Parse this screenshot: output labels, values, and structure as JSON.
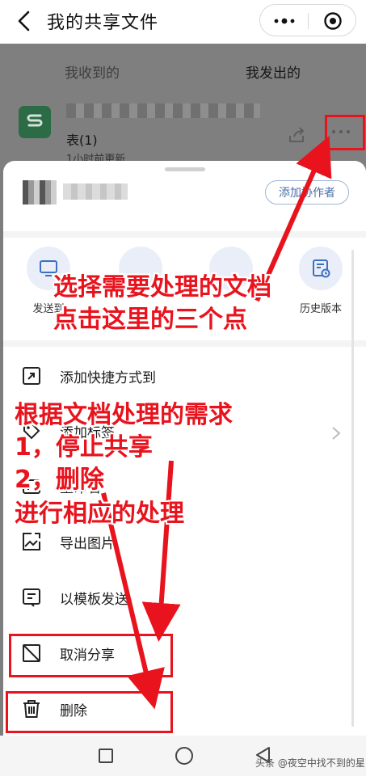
{
  "header": {
    "title": "我的共享文件"
  },
  "tabs": [
    {
      "label": "我收到的"
    },
    {
      "label": "我发出的"
    }
  ],
  "file": {
    "name_suffix": "表(1)",
    "updated": "1小时前更新"
  },
  "sheet": {
    "add_collaborator": "添加协作者",
    "actions": [
      {
        "label": "发送到",
        "icon": "send-icon"
      },
      {
        "label": "历史版本",
        "icon": "history-icon"
      }
    ],
    "menu": [
      {
        "label": "添加快捷方式到",
        "icon": "shortcut-icon"
      },
      {
        "label": "添加标签",
        "icon": "tag-icon"
      },
      {
        "label": "重命名",
        "icon": "rename-icon"
      },
      {
        "label": "导出图片",
        "icon": "export-image-icon"
      },
      {
        "label": "以模板发送",
        "icon": "template-icon"
      },
      {
        "label": "取消分享",
        "icon": "cancel-share-icon"
      },
      {
        "label": "删除",
        "icon": "trash-icon"
      }
    ]
  },
  "annotations": {
    "line1": "选择需要处理的文档",
    "line2": "点击这里的三个点",
    "line3": "根据文档处理的需求",
    "line4": "1，停止共享",
    "line5": "2，删除",
    "line6": "进行相应的处理"
  },
  "watermark": "头条 @夜空中找不到的星",
  "colors": {
    "annotation": "#e8131d",
    "accent": "#4d6fa9",
    "file_icon": "#2b6b45"
  }
}
